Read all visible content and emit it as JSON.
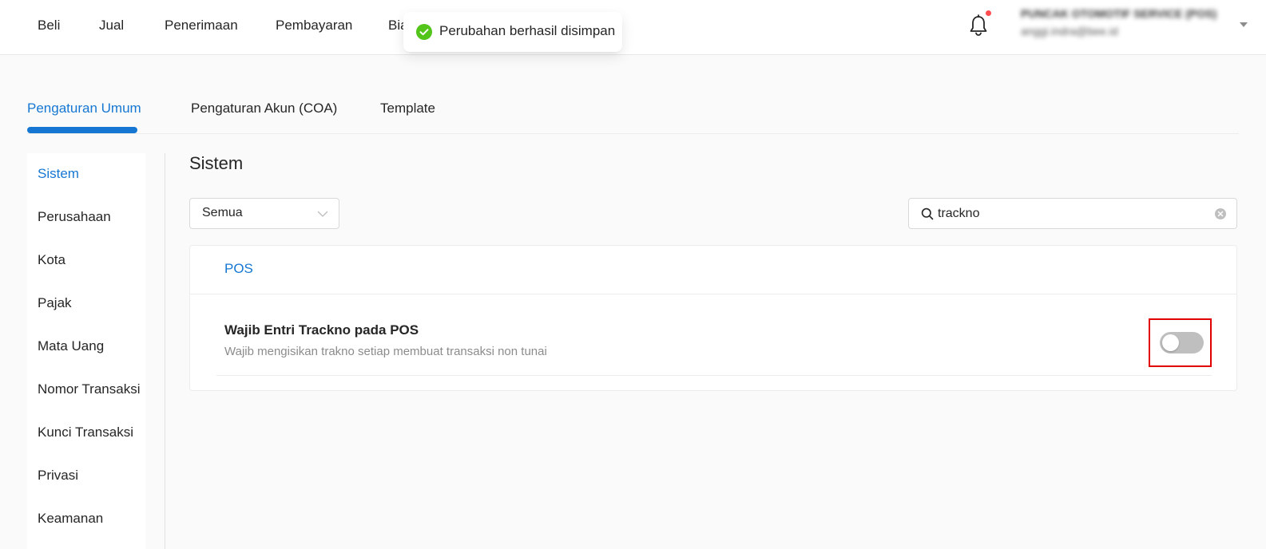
{
  "nav": {
    "items": [
      "Beli",
      "Jual",
      "Penerimaan",
      "Pembayaran",
      "Bia"
    ]
  },
  "toast": {
    "message": "Perubahan berhasil disimpan",
    "icon": "check-circle-icon",
    "color": "#52c41a"
  },
  "user": {
    "name": "PUNCAK OTOMOTIF SERVICE (POS)",
    "email": "anggi.indra@bee.id"
  },
  "notification": {
    "has_unread": true,
    "dot_color": "#ff4d4f"
  },
  "tabs": [
    {
      "label": "Pengaturan Umum",
      "active": true
    },
    {
      "label": "Pengaturan Akun (COA)",
      "active": false
    },
    {
      "label": "Template",
      "active": false
    }
  ],
  "sidebar": {
    "items": [
      {
        "label": "Sistem",
        "active": true
      },
      {
        "label": "Perusahaan",
        "active": false
      },
      {
        "label": "Kota",
        "active": false
      },
      {
        "label": "Pajak",
        "active": false
      },
      {
        "label": "Mata Uang",
        "active": false
      },
      {
        "label": "Nomor Transaksi",
        "active": false
      },
      {
        "label": "Kunci Transaksi",
        "active": false
      },
      {
        "label": "Privasi",
        "active": false
      },
      {
        "label": "Keamanan",
        "active": false
      }
    ]
  },
  "main": {
    "title": "Sistem",
    "filter": {
      "selected": "Semua"
    },
    "search": {
      "value": "trackno"
    },
    "group": {
      "label": "POS",
      "settings": [
        {
          "title": "Wajib Entri Trackno pada POS",
          "description": "Wajib mengisikan trakno setiap membuat transaksi non tunai",
          "enabled": false
        }
      ]
    }
  },
  "colors": {
    "accent": "#1677d2",
    "highlight": "#e00000",
    "switch_off": "#bfbfbf"
  }
}
